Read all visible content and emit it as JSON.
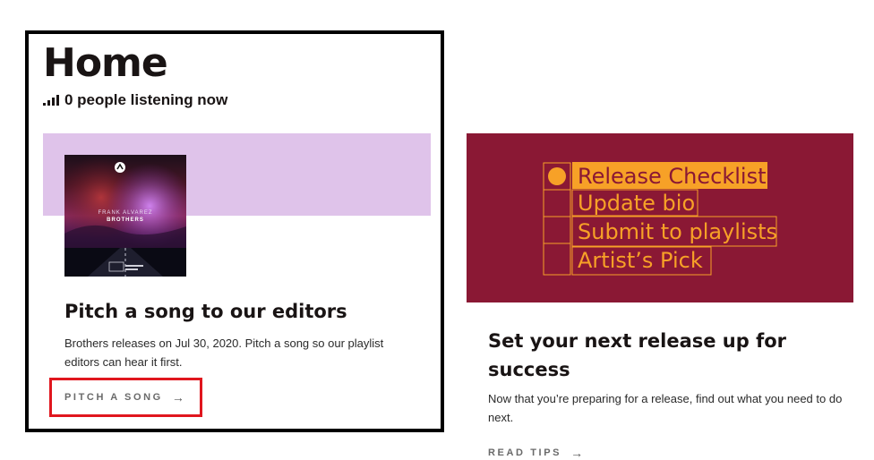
{
  "home": {
    "title": "Home",
    "listening_text": "0 people listening now",
    "listening_icon": "bars-icon"
  },
  "pitch_card": {
    "album_artist": "FRANK ALVAREZ",
    "album_title": "BROTHERS",
    "title": "Pitch a song to our editors",
    "description": "Brothers releases on Jul 30, 2020. Pitch a song so our playlist editors can hear it first.",
    "cta_label": "PITCH A SONG",
    "cta_icon": "arrow-right-icon",
    "banner_color": "#dfc3ea",
    "highlight_color": "#e0161e"
  },
  "promo_card": {
    "checklist_items": [
      "Release Checklist",
      "Update bio",
      "Submit to playlists",
      "Artist’s Pick"
    ],
    "title": "Set your next release up for success",
    "description": "Now that you’re preparing for a release, find out what you need to do next.",
    "cta_label": "READ TIPS",
    "cta_icon": "arrow-right-icon",
    "background_color": "#8a1834",
    "accent_color": "#f7a127"
  }
}
